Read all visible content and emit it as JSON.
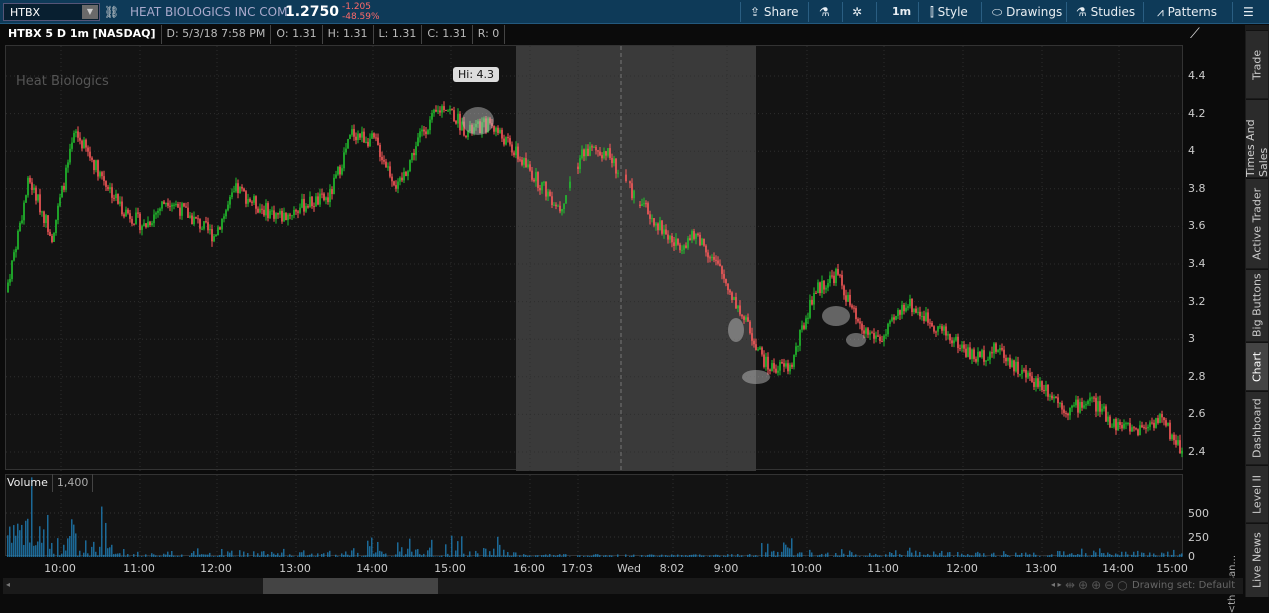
{
  "header": {
    "symbol": "HTBX",
    "company": "HEAT BIOLOGICS INC COM",
    "last": "1.2750",
    "change": "-1.205",
    "change_pct": "-48.59%"
  },
  "toolbar": {
    "share": "Share",
    "timeframe": "1m",
    "style": "Style",
    "drawings": "Drawings",
    "studies": "Studies",
    "patterns": "Patterns"
  },
  "info": {
    "title": "HTBX 5 D 1m [NASDAQ]",
    "date": "D: 5/3/18 7:58 PM",
    "open": "O: 1.31",
    "high": "H: 1.31",
    "low": "L: 1.31",
    "close": "C: 1.31",
    "range": "R: 0"
  },
  "chart": {
    "watermark": "Heat Biologics",
    "hi_label": "Hi: 4.3",
    "price_ticks": [
      "4.4",
      "4.2",
      "4",
      "3.8",
      "3.6",
      "3.4",
      "3.2",
      "3",
      "2.8",
      "2.6",
      "2.4"
    ],
    "time_ticks": [
      "10:00",
      "11:00",
      "12:00",
      "13:00",
      "14:00",
      "15:00",
      "16:00",
      "17:03",
      "Wed",
      "8:02",
      "9:00",
      "10:00",
      "11:00",
      "12:00",
      "13:00",
      "14:00",
      "15:00"
    ],
    "colors": {
      "up": "#22c32e",
      "down": "#ff5a5a",
      "volume": "#1f7fb8"
    }
  },
  "chart_data": {
    "type": "candlestick",
    "ylim": [
      2.4,
      4.4
    ],
    "price_path": [
      [
        0,
        3.25
      ],
      [
        1,
        3.85
      ],
      [
        2,
        3.55
      ],
      [
        3,
        4.1
      ],
      [
        4,
        3.9
      ],
      [
        5,
        3.7
      ],
      [
        6,
        3.6
      ],
      [
        7,
        3.75
      ],
      [
        8,
        3.65
      ],
      [
        9,
        3.55
      ],
      [
        10,
        3.8
      ],
      [
        11,
        3.7
      ],
      [
        12,
        3.65
      ],
      [
        13,
        3.72
      ],
      [
        14,
        3.75
      ],
      [
        15,
        4.1
      ],
      [
        16,
        4.05
      ],
      [
        17,
        3.8
      ],
      [
        18,
        4.1
      ],
      [
        19,
        4.25
      ],
      [
        20,
        4.1
      ],
      [
        21,
        4.15
      ],
      [
        22,
        4.0
      ],
      [
        23,
        3.85
      ],
      [
        24,
        3.7
      ],
      [
        25,
        4.0
      ],
      [
        26,
        4.0
      ],
      [
        27,
        3.8
      ],
      [
        28,
        3.65
      ],
      [
        29,
        3.5
      ],
      [
        30,
        3.55
      ],
      [
        31,
        3.35
      ],
      [
        32,
        3.1
      ],
      [
        33,
        2.85
      ],
      [
        34,
        2.85
      ],
      [
        35,
        3.25
      ],
      [
        36,
        3.35
      ],
      [
        37,
        3.05
      ],
      [
        38,
        3.0
      ],
      [
        39,
        3.2
      ],
      [
        40,
        3.1
      ],
      [
        41,
        3.0
      ],
      [
        42,
        2.9
      ],
      [
        43,
        2.95
      ],
      [
        44,
        2.82
      ],
      [
        45,
        2.75
      ],
      [
        46,
        2.62
      ],
      [
        47,
        2.68
      ],
      [
        48,
        2.55
      ],
      [
        49,
        2.52
      ],
      [
        50,
        2.58
      ],
      [
        51,
        2.4
      ]
    ]
  },
  "volume": {
    "label": "Volume",
    "value": "1,400",
    "ticks": [
      "500",
      "250",
      "0"
    ],
    "unit": "<thousan..."
  },
  "sidebar": {
    "tabs": [
      "Trade",
      "Times And Sales",
      "Active Trader",
      "Big Buttons",
      "Chart",
      "Dashboard",
      "Level II",
      "Live News"
    ]
  },
  "footer": {
    "drawing_set": "Drawing set: Default"
  }
}
